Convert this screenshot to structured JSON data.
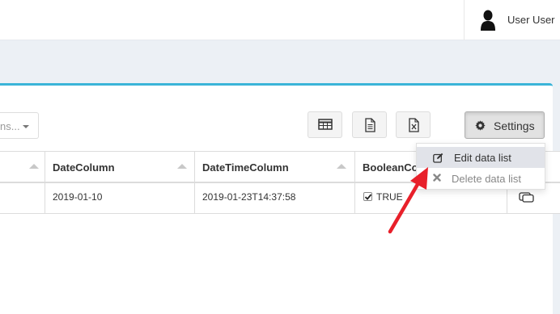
{
  "header": {
    "user_name": "User User",
    "avatar_icon": "user-silhouette-icon"
  },
  "toolbar": {
    "columns_select_text": "ns...",
    "export_buttons": [
      {
        "name": "table-view-icon"
      },
      {
        "name": "document-export-icon"
      },
      {
        "name": "excel-export-icon"
      }
    ],
    "settings_label": "Settings"
  },
  "table": {
    "columns": [
      "DateColumn",
      "DateTimeColumn",
      "BooleanCo"
    ],
    "rows": [
      {
        "date": "2019-01-10",
        "datetime": "2019-01-23T14:37:58",
        "boolean": "TRUE"
      }
    ]
  },
  "settings_menu": {
    "items": [
      {
        "label": "Edit data list",
        "icon": "edit-icon",
        "state": "active"
      },
      {
        "label": "Delete data list",
        "icon": "close-icon",
        "state": "disabled"
      }
    ]
  },
  "colors": {
    "accent": "#3bb4d8",
    "annotation_arrow": "#e8202a",
    "background": "#ecf0f5"
  }
}
